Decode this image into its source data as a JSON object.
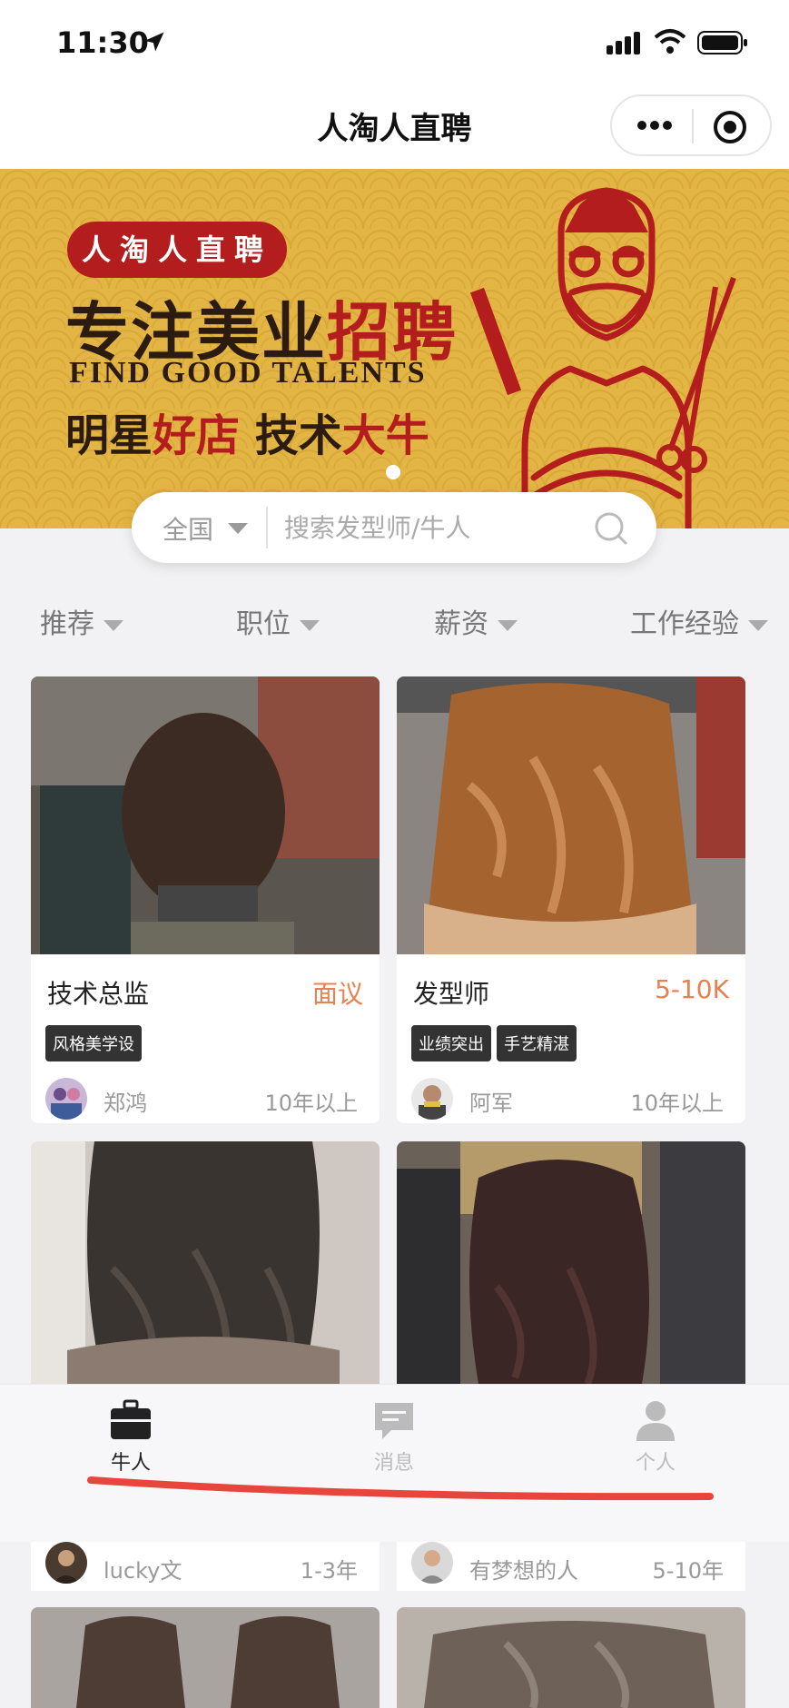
{
  "status_bar": {
    "time": "11:30"
  },
  "nav": {
    "title": "人淘人直聘",
    "more_icon": "more-dots-icon",
    "close_icon": "target-close-icon"
  },
  "banner": {
    "badge": "人淘人直聘",
    "slogan_part1": "专注美业",
    "slogan_part2": "招聘",
    "english": "FIND GOOD TALENTS",
    "line3_a": "明星",
    "line3_b": "好店",
    "line3_c": " 技术",
    "line3_d": "大牛",
    "colors": {
      "bg": "#e3b544",
      "red": "#b31d1d",
      "dark": "#2b1b10"
    }
  },
  "search": {
    "region": "全国",
    "placeholder": "搜索发型师/牛人"
  },
  "filters": [
    {
      "label": "推荐"
    },
    {
      "label": "职位"
    },
    {
      "label": "薪资"
    },
    {
      "label": "工作经验"
    }
  ],
  "cards": [
    {
      "title": "技术总监",
      "salary": "面议",
      "tags": [
        "风格美学设"
      ],
      "user": "郑鸿",
      "experience": "10年以上"
    },
    {
      "title": "发型师",
      "salary": "5-10K",
      "tags": [
        "业绩突出",
        "手艺精湛"
      ],
      "user": "阿军",
      "experience": "10年以上"
    }
  ],
  "lower_cards": [
    {
      "user": "lucky文",
      "experience": "1-3年"
    },
    {
      "user": "有梦想的人",
      "experience": "5-10年"
    }
  ],
  "tabbar": {
    "tabs": [
      {
        "label": "牛人",
        "icon": "briefcase-icon",
        "active": true
      },
      {
        "label": "消息",
        "icon": "message-icon",
        "active": false
      },
      {
        "label": "个人",
        "icon": "person-icon",
        "active": false
      }
    ],
    "active_color": "#222222",
    "inactive_color": "#bbbbbb"
  },
  "accent": {
    "salary": "#e8804f",
    "annotation_underline": "#e8453c"
  }
}
